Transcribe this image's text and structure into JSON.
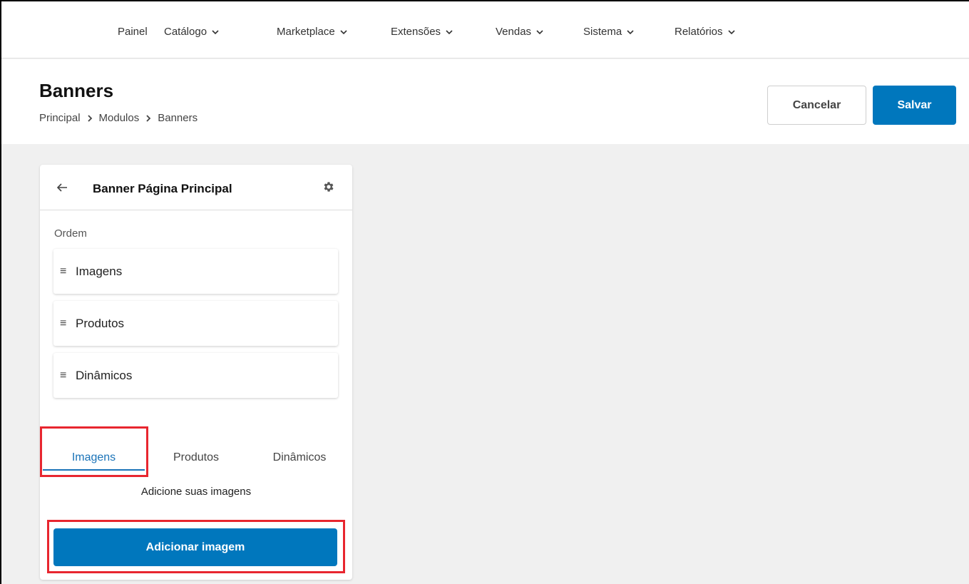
{
  "nav": {
    "items": [
      {
        "label": "Painel",
        "has_dropdown": false
      },
      {
        "label": "Catálogo",
        "has_dropdown": true
      },
      {
        "label": "Marketplace",
        "has_dropdown": true
      },
      {
        "label": "Extensões",
        "has_dropdown": true
      },
      {
        "label": "Vendas",
        "has_dropdown": true
      },
      {
        "label": "Sistema",
        "has_dropdown": true
      },
      {
        "label": "Relatórios",
        "has_dropdown": true
      }
    ]
  },
  "header": {
    "title": "Banners",
    "breadcrumb": [
      "Principal",
      "Modulos",
      "Banners"
    ],
    "cancel_label": "Cancelar",
    "save_label": "Salvar"
  },
  "card": {
    "title": "Banner Página Principal",
    "order_label": "Ordem",
    "order_items": [
      "Imagens",
      "Produtos",
      "Dinâmicos"
    ],
    "tabs": [
      {
        "label": "Imagens",
        "active": true
      },
      {
        "label": "Produtos",
        "active": false
      },
      {
        "label": "Dinâmicos",
        "active": false
      }
    ],
    "hint": "Adicione suas imagens",
    "add_button_label": "Adicionar imagem"
  },
  "colors": {
    "primary": "#0077bd",
    "active_tab": "#1a73b8",
    "highlight": "#e8262f",
    "background": "#f0f0f0"
  },
  "icons": {
    "dropdown": "chevron-down-icon",
    "breadcrumb_separator": "chevron-right-icon",
    "back": "arrow-left-icon",
    "settings": "gear-icon",
    "drag": "drag-handle-icon"
  }
}
